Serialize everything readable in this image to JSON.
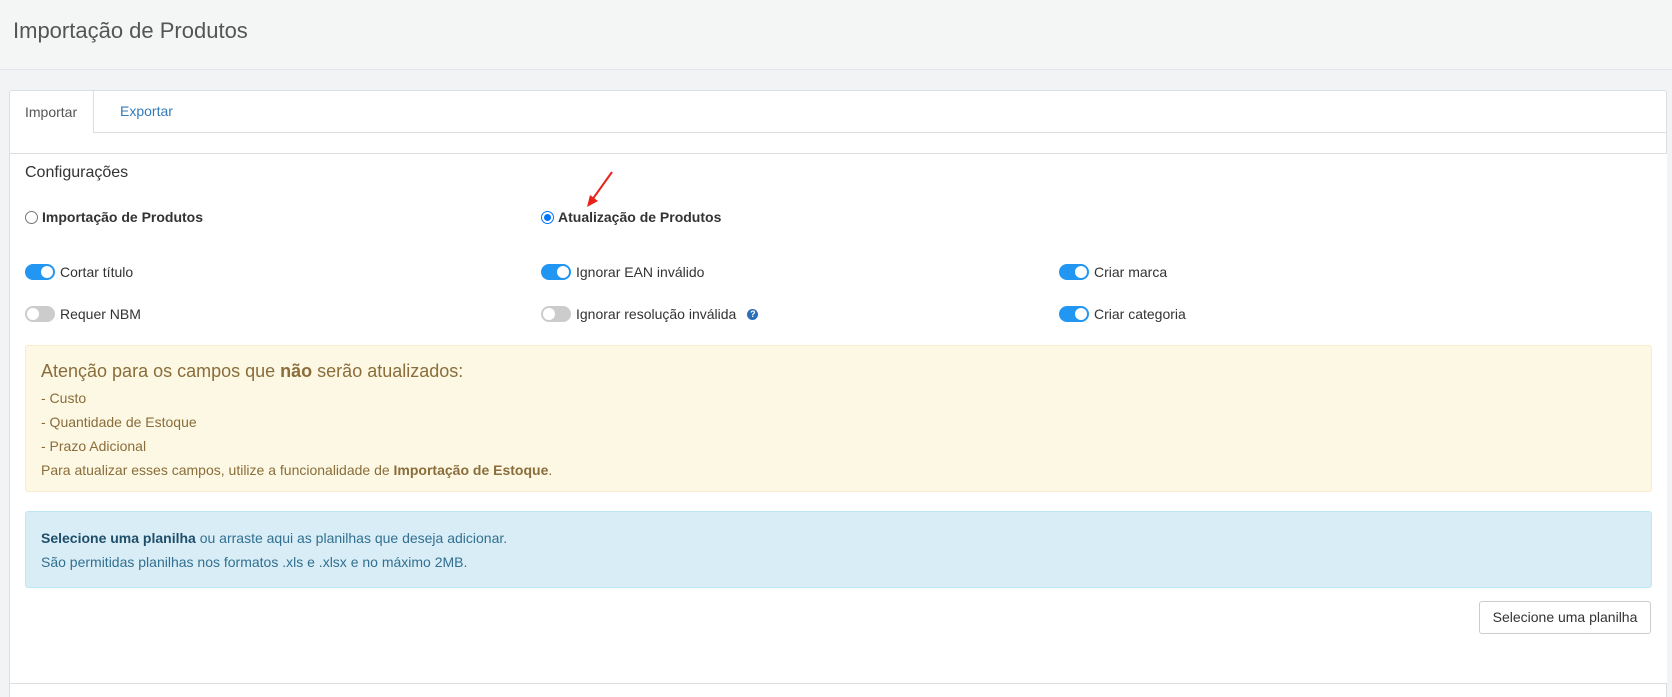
{
  "page": {
    "title": "Importação de Produtos"
  },
  "tabs": [
    {
      "label": "Importar",
      "active": true
    },
    {
      "label": "Exportar",
      "active": false
    }
  ],
  "config": {
    "title": "Configurações",
    "modes": [
      {
        "label": "Importação de Produtos",
        "checked": false
      },
      {
        "label": "Atualização de Produtos",
        "checked": true
      }
    ],
    "toggles": [
      {
        "label": "Cortar título",
        "on": true
      },
      {
        "label": "Ignorar EAN inválido",
        "on": true
      },
      {
        "label": "Criar marca",
        "on": true
      },
      {
        "label": "Requer NBM",
        "on": false
      },
      {
        "label": "Ignorar resolução inválida",
        "on": false,
        "help_icon": "question-circle-icon"
      },
      {
        "label": "Criar categoria",
        "on": true
      }
    ]
  },
  "warning": {
    "title_prefix": "Atenção para os campos que ",
    "title_bold": "não",
    "title_suffix": " serão atualizados:",
    "items": [
      "- Custo",
      "- Quantidade de Estoque",
      "- Prazo Adicional"
    ],
    "note_prefix": "Para atualizar esses campos, utilize a funcionalidade de ",
    "note_bold": "Importação de Estoque",
    "note_suffix": "."
  },
  "upload_info": {
    "line1_bold": "Selecione uma planilha",
    "line1_rest": " ou arraste aqui as planilhas que deseja adicionar.",
    "line2": "São permitidas planilhas nos formatos .xls e .xlsx e no máximo 2MB."
  },
  "buttons": {
    "select_sheet": "Selecione uma planilha"
  },
  "colors": {
    "accent": "#2196f3",
    "link": "#337ab7",
    "warning_bg": "#fcf8e3",
    "info_bg": "#d9edf7",
    "annotation_arrow": "#e8231a"
  }
}
